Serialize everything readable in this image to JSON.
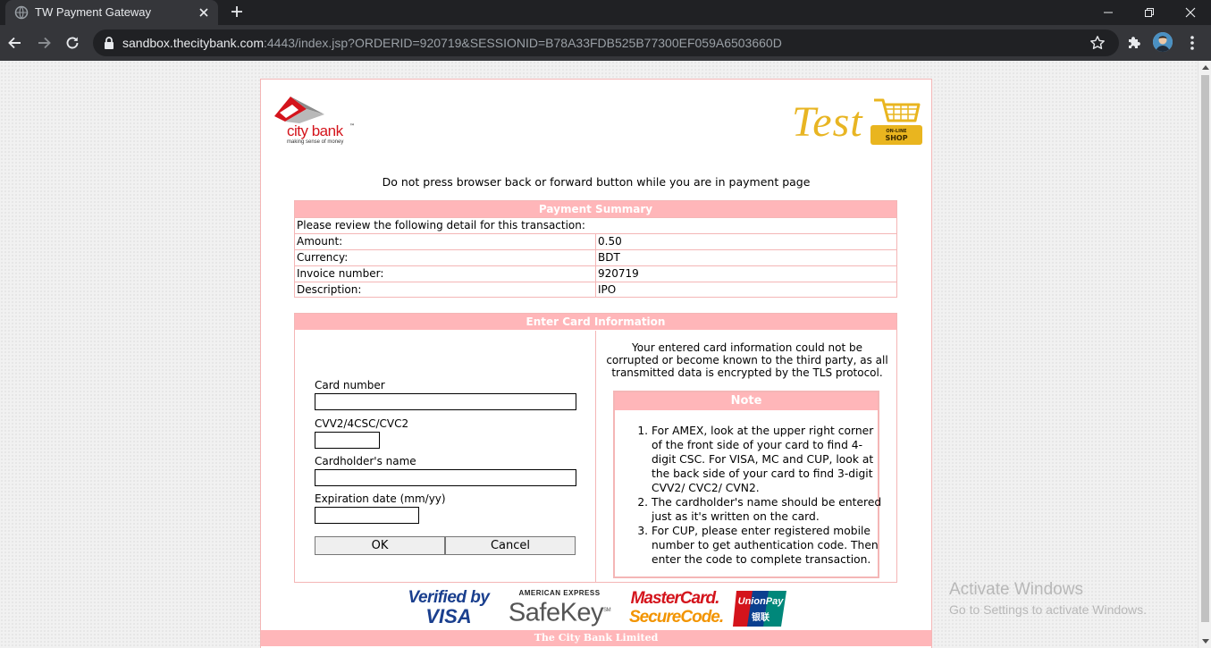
{
  "browser": {
    "tab_title": "TW Payment Gateway",
    "url_host": "sandbox.thecitybank.com",
    "url_rest": ":4443/index.jsp?ORDERID=920719&SESSIONID=B78A33FDB525B77300EF059A6503660D"
  },
  "logos": {
    "city_bank_name": "city bank",
    "city_bank_tm": "™",
    "city_bank_tagline": "making sense of money",
    "test_word": "Test",
    "shop_top": "ON-LINE",
    "shop_bottom": "SHOP"
  },
  "warning": "Do not press browser back or forward button while you are in payment page",
  "summary": {
    "heading": "Payment Summary",
    "intro": "Please review the following detail for this transaction:",
    "rows": [
      {
        "label": "Amount:",
        "value": "0.50"
      },
      {
        "label": "Currency:",
        "value": "BDT"
      },
      {
        "label": "Invoice number:",
        "value": "920719"
      },
      {
        "label": "Description:",
        "value": "IPO"
      }
    ]
  },
  "card": {
    "heading": "Enter Card Information",
    "card_number_label": "Card number",
    "cvv_label": "CVV2/4CSC/CVC2",
    "name_label": "Cardholder's name",
    "expiry_label": "Expiration date (mm/yy)",
    "card_number_value": "",
    "cvv_value": "",
    "name_value": "",
    "expiry_value": "",
    "ok_label": "OK",
    "cancel_label": "Cancel",
    "security_text": "Your entered card information could not be corrupted or become known to the third party, as all transmitted data is encrypted by the TLS protocol."
  },
  "note": {
    "heading": "Note",
    "items": [
      "For AMEX, look at the upper right corner of the front side of your card to find 4-digit CSC. For VISA, MC and CUP, look at the back side of your card to find 3-digit CVV2/ CVC2/ CVN2.",
      "The cardholder's name should be entered just as it's written on the card.",
      "For CUP, please enter registered mobile number to get authentication code. Then enter the code to complete transaction."
    ]
  },
  "brands": {
    "verified_1": "Verified by",
    "verified_2": "VISA",
    "amex": "AMERICAN EXPRESS",
    "safekey": "SafeKey",
    "safekey_sm": "SM",
    "mastercard": "MasterCard.",
    "securecode": "SecureCode.",
    "unionpay": "UnionPay",
    "unionpay_cn": "银联"
  },
  "footer": "The City Bank Limited",
  "watermark": {
    "line1": "Activate Windows",
    "line2": "Go to Settings to activate Windows."
  },
  "colors": {
    "accent_pink": "#ffb6b9",
    "border_pink": "#f4b6b6",
    "citybank_red": "#d4141c",
    "test_gold": "#e8b523"
  }
}
